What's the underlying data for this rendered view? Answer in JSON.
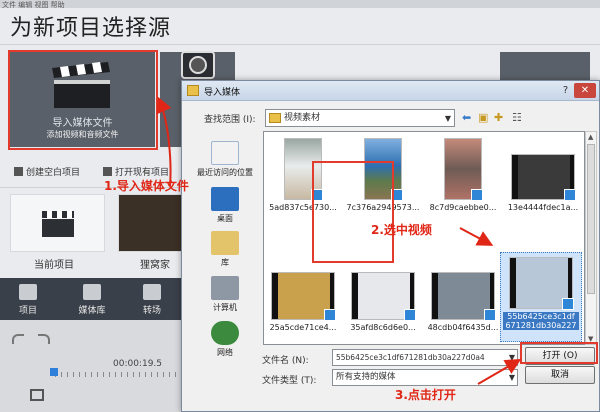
{
  "app": {
    "top_strip": "文件  编辑  视图  帮助",
    "title": "为新项目选择源",
    "import_tile": {
      "line1": "导入媒体文件",
      "line2": "添加视频和音频文件"
    },
    "links": {
      "create_empty": "创建空白项目",
      "open_existing": "打开现有项目"
    },
    "projects": [
      {
        "label": "当前项目"
      },
      {
        "label": "狸窝家"
      }
    ],
    "bottom_tabs": [
      {
        "label": "项目"
      },
      {
        "label": "媒体库"
      },
      {
        "label": "转场"
      }
    ],
    "timeline": {
      "time": "00:00:19.5"
    }
  },
  "dialog": {
    "title": "导入媒体",
    "help": "?",
    "close": "✕",
    "lookin_label": "查找范围 (I):",
    "lookin_value": "视频素材",
    "places": [
      "最近访问的位置",
      "桌面",
      "库",
      "计算机",
      "网络"
    ],
    "files": [
      {
        "name": "5ad837c5e730..."
      },
      {
        "name": "7c376a2949573..."
      },
      {
        "name": "8c7d9caebbe0..."
      },
      {
        "name": "13e4444fdec1a..."
      },
      {
        "name": "25a5cde71ce4..."
      },
      {
        "name": "35afd8c6d6e0..."
      },
      {
        "name": "48cdb04f6435d..."
      },
      {
        "name": "55b6425ce3c1df",
        "name_line2": "671281db30a227"
      }
    ],
    "filename_label": "文件名 (N):",
    "filename_value": "55b6425ce3c1df671281db30a227d0a4",
    "filetype_label": "文件类型 (T):",
    "filetype_value": "所有支持的媒体",
    "open_label": "打开 (O)",
    "cancel_label": "取消"
  },
  "annotations": {
    "step1": "1.导入媒体文件",
    "step2": "2.选中视频",
    "step3": "3.点击打开"
  },
  "colors": {
    "annotation": "#e02616",
    "selection": "#3a78c3",
    "dialog_bg": "#f0f0f0"
  }
}
